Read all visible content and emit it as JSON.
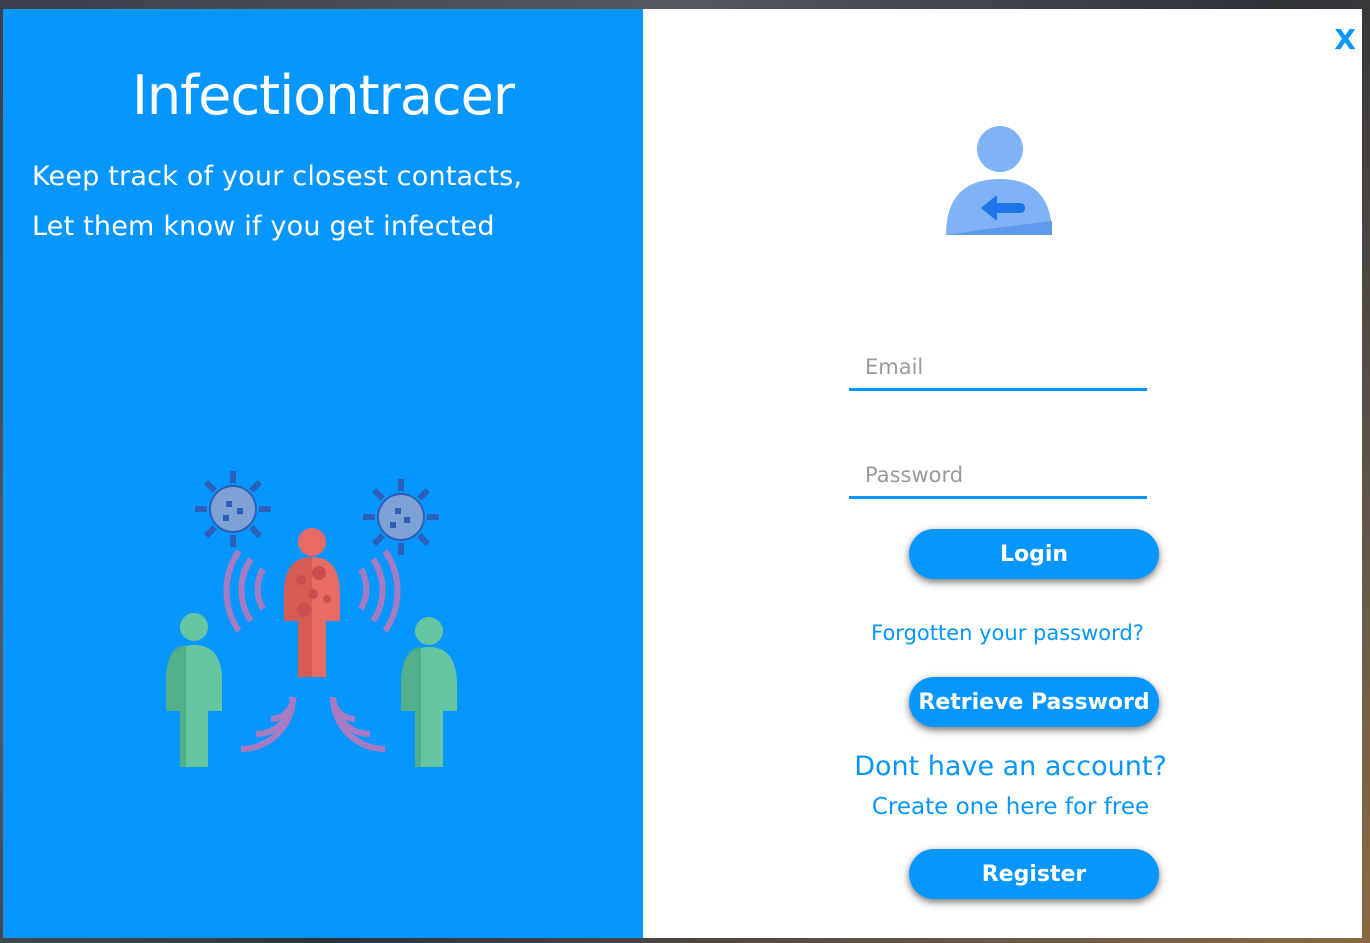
{
  "brand": {
    "title": "Infectiontracer",
    "tagline_line1": "Keep track of your closest contacts,",
    "tagline_line2": "Let them know if you get infected"
  },
  "window": {
    "close_label": "X"
  },
  "login_form": {
    "email_placeholder": "Email",
    "email_value": "",
    "password_placeholder": "Password",
    "password_value": "",
    "login_label": "Login",
    "forgot_password_text": "Forgotten your password?",
    "retrieve_password_label": "Retrieve Password",
    "no_account_text": "Dont have an account?",
    "create_account_text": "Create one here for free",
    "register_label": "Register"
  },
  "icons": {
    "avatar": "user-login-icon",
    "illustration": "infection-spread-illustration",
    "virus": "virus-icon",
    "infected_person": "infected-person-icon",
    "healthy_person": "person-icon"
  },
  "colors": {
    "accent": "#0796fd",
    "panel_bg": "#ffffff",
    "infected": "#e76a66",
    "healthy": "#66c6a1",
    "virus": "#6f9ad8",
    "signal": "#a67bbf"
  }
}
